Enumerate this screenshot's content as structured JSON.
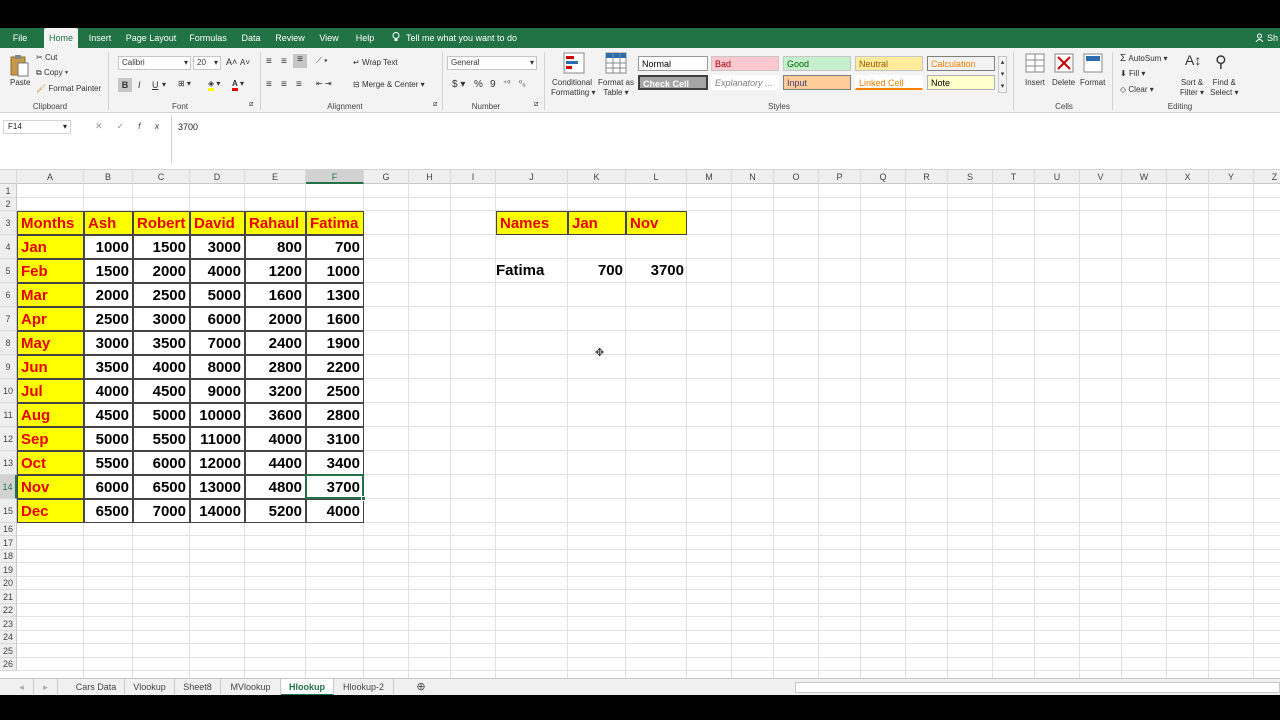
{
  "menu_tabs": [
    "File",
    "Home",
    "Insert",
    "Page Layout",
    "Formulas",
    "Data",
    "Review",
    "View",
    "Help"
  ],
  "active_tab": "Home",
  "tell_me": "Tell me what you want to do",
  "user": "Sh",
  "ribbon": {
    "clipboard": {
      "paste": "Paste",
      "cut": "Cut",
      "copy": "Copy",
      "format_painter": "Format Painter",
      "label": "Clipboard"
    },
    "font": {
      "name": "Calibri",
      "size": "20",
      "bold": "B",
      "italic": "I",
      "underline": "U",
      "label": "Font"
    },
    "alignment": {
      "wrap": "Wrap Text",
      "merge": "Merge & Center",
      "label": "Alignment"
    },
    "number": {
      "format": "General",
      "currency": "$",
      "percent": "%",
      "comma": "9",
      "label": "Number"
    },
    "styles": {
      "conditional_1": "Conditional",
      "conditional_2": "Formatting",
      "format_table_1": "Format as",
      "format_table_2": "Table",
      "cells": [
        "Normal",
        "Bad",
        "Good",
        "Neutral",
        "Calculation",
        "Check Cell",
        "Explanatory ...",
        "Input",
        "Linked Cell",
        "Note"
      ],
      "label": "Styles"
    },
    "cells": {
      "insert": "Insert",
      "delete": "Delete",
      "format": "Format",
      "label": "Cells"
    },
    "editing": {
      "autosum": "AutoSum",
      "fill": "Fill",
      "clear": "Clear",
      "sort_1": "Sort &",
      "sort_2": "Filter",
      "find_1": "Find &",
      "find_2": "Select",
      "label": "Editing"
    }
  },
  "formula_bar": {
    "name_box": "F14",
    "cancel": "✕",
    "enter": "✓",
    "fx": "fx",
    "value": "3700"
  },
  "columns": [
    "A",
    "B",
    "C",
    "D",
    "E",
    "F",
    "G",
    "H",
    "I",
    "J",
    "K",
    "L",
    "M",
    "N",
    "O",
    "P",
    "Q",
    "R",
    "S",
    "T",
    "U",
    "V",
    "W",
    "X",
    "Y",
    "Z"
  ],
  "selected_column": "F",
  "selected_row": "14",
  "row_numbers": [
    "1",
    "2",
    "3",
    "4",
    "5",
    "6",
    "7",
    "8",
    "9",
    "10",
    "11",
    "12",
    "13",
    "14",
    "15",
    "16",
    "17",
    "18",
    "19",
    "20",
    "21",
    "22",
    "23",
    "24",
    "25",
    "26"
  ],
  "table": {
    "headers": [
      "Months",
      "Ash",
      "Robert",
      "David",
      "Rahaul",
      "Fatima"
    ],
    "rows": [
      [
        "Jan",
        "1000",
        "1500",
        "3000",
        "800",
        "700"
      ],
      [
        "Feb",
        "1500",
        "2000",
        "4000",
        "1200",
        "1000"
      ],
      [
        "Mar",
        "2000",
        "2500",
        "5000",
        "1600",
        "1300"
      ],
      [
        "Apr",
        "2500",
        "3000",
        "6000",
        "2000",
        "1600"
      ],
      [
        "May",
        "3000",
        "3500",
        "7000",
        "2400",
        "1900"
      ],
      [
        "Jun",
        "3500",
        "4000",
        "8000",
        "2800",
        "2200"
      ],
      [
        "Jul",
        "4000",
        "4500",
        "9000",
        "3200",
        "2500"
      ],
      [
        "Aug",
        "4500",
        "5000",
        "10000",
        "3600",
        "2800"
      ],
      [
        "Sep",
        "5000",
        "5500",
        "11000",
        "4000",
        "3100"
      ],
      [
        "Oct",
        "5500",
        "6000",
        "12000",
        "4400",
        "3400"
      ],
      [
        "Nov",
        "6000",
        "6500",
        "13000",
        "4800",
        "3700"
      ],
      [
        "Dec",
        "6500",
        "7000",
        "14000",
        "5200",
        "4000"
      ]
    ]
  },
  "lookup": {
    "headers": [
      "Names",
      "Jan",
      "Nov"
    ],
    "row": [
      "Fatima",
      "700",
      "3700"
    ]
  },
  "sheet_tabs": [
    "Cars Data",
    "Vlookup",
    "Sheet8",
    "MVlookup",
    "Hlookup",
    "Hlookup-2"
  ],
  "active_sheet": "Hlookup",
  "colors": {
    "excel_green": "#217346",
    "header_fill": "#ffff00",
    "header_text": "#e60000"
  }
}
